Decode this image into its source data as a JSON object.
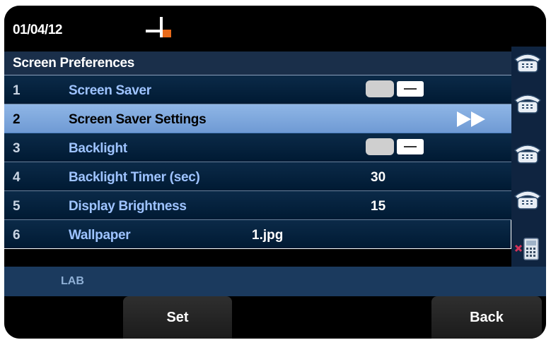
{
  "status": {
    "date": "01/04/12"
  },
  "header": {
    "title": "Screen Preferences"
  },
  "rows": [
    {
      "num": "1",
      "label": "Screen Saver",
      "value": ""
    },
    {
      "num": "2",
      "label": "Screen Saver Settings",
      "value": ""
    },
    {
      "num": "3",
      "label": "Backlight",
      "value": ""
    },
    {
      "num": "4",
      "label": "Backlight Timer (sec)",
      "value": "30"
    },
    {
      "num": "5",
      "label": "Display Brightness",
      "value": "15"
    },
    {
      "num": "6",
      "label": "Wallpaper",
      "value": "1.jpg"
    }
  ],
  "selected_row": "2",
  "toggles": {
    "screen_saver": "off",
    "backlight": "off"
  },
  "footer": {
    "label": "LAB"
  },
  "softkeys": {
    "set": "Set",
    "back": "Back"
  },
  "colors": {
    "selected_row": "#7fa8de",
    "row_bg": "#001a33",
    "label_text": "#9ec3ff",
    "status_accent": "#e86a1a"
  },
  "icons": [
    "network-status-icon",
    "line-phone-icon",
    "keypad-phone-icon",
    "forward-arrow-icon",
    "toggle-switch-icon"
  ]
}
